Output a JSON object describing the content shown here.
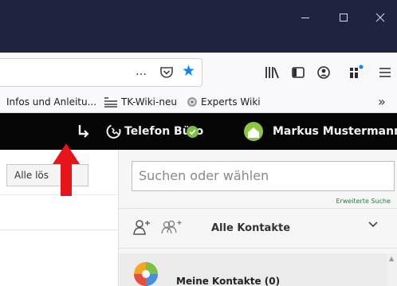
{
  "window": {
    "controls": {
      "minimize": "minimize",
      "maximize": "maximize",
      "close": "close"
    }
  },
  "toolbar": {
    "url_more": "…",
    "icons": [
      "pocket-icon",
      "star-icon",
      "library-icon",
      "sidebar-icon",
      "account-icon",
      "extension-icon",
      "menu-icon"
    ]
  },
  "bookmarks": {
    "items": [
      {
        "label": "Infos und Anleitu..."
      },
      {
        "label": "TK-Wiki-neu"
      },
      {
        "label": "Experts Wiki"
      }
    ],
    "overflow": "»"
  },
  "appbar": {
    "phone_label": "Telefon Büro",
    "user_name": "Markus Mustermann",
    "status_color": "#7ac143"
  },
  "left": {
    "button_label": "Alle lös"
  },
  "contacts": {
    "search_placeholder": "Suchen oder wählen",
    "advanced_search": "Erweiterte Suche",
    "filter_label": "Alle Kontakte",
    "list": [
      {
        "label": "Meine Kontakte (0)"
      }
    ]
  },
  "colors": {
    "titlebar": "#202340",
    "appbar": "#050505",
    "accent_green": "#7ac143",
    "star_blue": "#0a84ff",
    "annotation_arrow": "#e8141b"
  }
}
